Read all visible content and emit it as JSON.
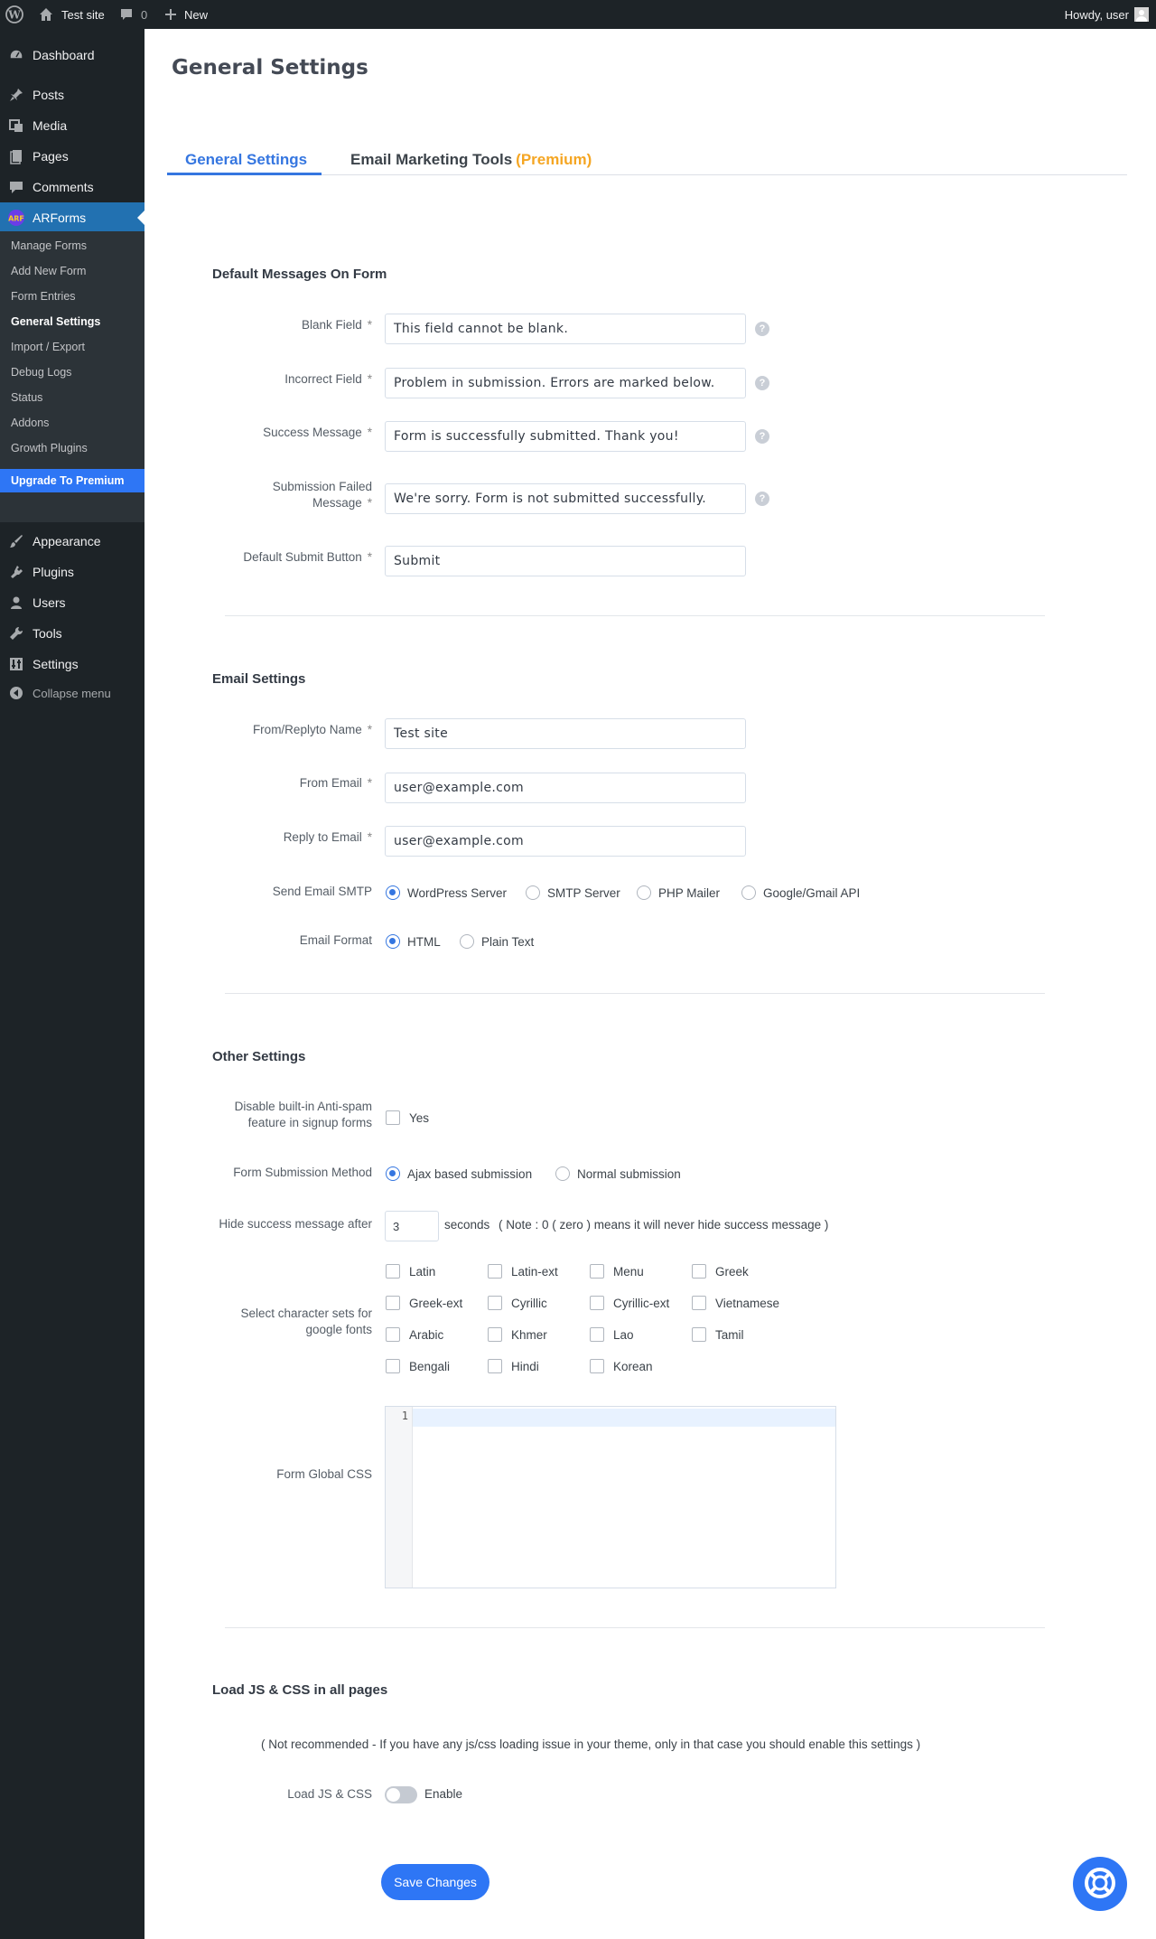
{
  "adminbar": {
    "site_name": "Test site",
    "comments_count": "0",
    "new_label": "New",
    "howdy": "Howdy, user"
  },
  "sidebar": {
    "items": [
      {
        "label": "Dashboard",
        "icon": "dashboard-icon"
      },
      {
        "label": "Posts",
        "icon": "pin-icon"
      },
      {
        "label": "Media",
        "icon": "media-icon"
      },
      {
        "label": "Pages",
        "icon": "pages-icon"
      },
      {
        "label": "Comments",
        "icon": "comment-icon"
      },
      {
        "label": "ARForms",
        "icon": "arforms-icon"
      },
      {
        "label": "Appearance",
        "icon": "brush-icon"
      },
      {
        "label": "Plugins",
        "icon": "plug-icon"
      },
      {
        "label": "Users",
        "icon": "user-icon"
      },
      {
        "label": "Tools",
        "icon": "wrench-icon"
      },
      {
        "label": "Settings",
        "icon": "settings-icon"
      },
      {
        "label": "Collapse menu",
        "icon": "collapse-icon"
      }
    ],
    "submenu": [
      "Manage Forms",
      "Add New Form",
      "Form Entries",
      "General Settings",
      "Import / Export",
      "Debug Logs",
      "Status",
      "Addons",
      "Growth Plugins",
      "Upgrade To Premium"
    ]
  },
  "page": {
    "title": "General Settings",
    "tabs": [
      {
        "label": "General Settings"
      },
      {
        "label": "Email Marketing Tools",
        "badge": "(Premium)"
      }
    ]
  },
  "default_messages": {
    "heading": "Default Messages On Form",
    "fields": [
      {
        "label": "Blank Field",
        "value": "This field cannot be blank."
      },
      {
        "label": "Incorrect Field",
        "value": "Problem in submission. Errors are marked below."
      },
      {
        "label": "Success Message",
        "value": "Form is successfully submitted. Thank you!"
      },
      {
        "label_line1": "Submission Failed",
        "label_line2": "Message",
        "value": "We're sorry. Form is not submitted successfully."
      },
      {
        "label": "Default Submit Button",
        "value": "Submit"
      }
    ],
    "required_mark": "*",
    "help_glyph": "?"
  },
  "email_settings": {
    "heading": "Email Settings",
    "from_name": {
      "label": "From/Replyto Name",
      "value": "Test site"
    },
    "from_email": {
      "label": "From Email",
      "value": "user@example.com"
    },
    "reply_email": {
      "label": "Reply to Email",
      "value": "user@example.com"
    },
    "smtp": {
      "label": "Send Email SMTP",
      "options": [
        "WordPress Server",
        "SMTP Server",
        "PHP Mailer",
        "Google/Gmail API"
      ],
      "selected": "WordPress Server"
    },
    "format": {
      "label": "Email Format",
      "options": [
        "HTML",
        "Plain Text"
      ],
      "selected": "HTML"
    }
  },
  "other_settings": {
    "heading": "Other Settings",
    "antispam": {
      "label_line1": "Disable built-in Anti-spam",
      "label_line2": "feature in signup forms",
      "option": "Yes",
      "checked": false
    },
    "submission": {
      "label": "Form Submission Method",
      "options": [
        "Ajax based submission",
        "Normal submission"
      ],
      "selected": "Ajax based submission"
    },
    "hide_success": {
      "label": "Hide success message after",
      "value": "3",
      "unit": "seconds",
      "note": "( Note : 0 ( zero ) means it will never hide success message )"
    },
    "charsets": {
      "label_line1": "Select character sets for",
      "label_line2": "google fonts",
      "options": [
        "Latin",
        "Latin-ext",
        "Menu",
        "Greek",
        "Greek-ext",
        "Cyrillic",
        "Cyrillic-ext",
        "Vietnamese",
        "Arabic",
        "Khmer",
        "Lao",
        "Tamil",
        "Bengali",
        "Hindi",
        "Korean"
      ]
    },
    "global_css": {
      "label": "Form Global CSS",
      "line_number": "1"
    }
  },
  "load_js": {
    "heading": "Load JS & CSS in all pages",
    "note": "( Not recommended - If you have any js/css loading issue in your theme, only in that case you should enable this settings )",
    "label": "Load JS & CSS",
    "toggle_label": "Enable",
    "enabled": false
  },
  "save_button": "Save Changes",
  "colors": {
    "accent": "#2e76f5",
    "tab_active": "#3576e0",
    "premium": "#f5a623",
    "sidebar_bg": "#1d2327",
    "submenu_bg": "#2c3338"
  }
}
